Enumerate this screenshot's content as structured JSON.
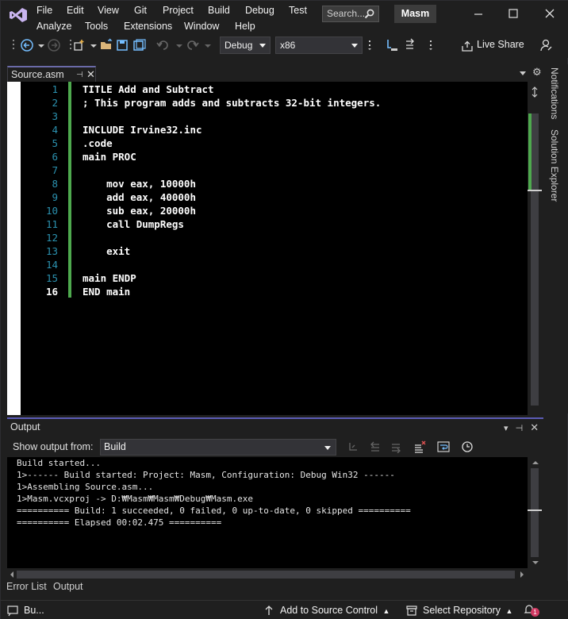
{
  "menu": {
    "row1": [
      "File",
      "Edit",
      "View",
      "Git",
      "Project",
      "Build",
      "Debug",
      "Test"
    ],
    "row2": [
      "Analyze",
      "Tools",
      "Extensions",
      "Window",
      "Help"
    ]
  },
  "search": {
    "placeholder": "Search..."
  },
  "solution_name": "Masm",
  "toolbar": {
    "configuration": "Debug",
    "platform": "x86",
    "live_share": "Live Share"
  },
  "editor": {
    "tab_label": "Source.asm",
    "lines": [
      {
        "n": "1",
        "text": "TITLE Add and Subtract"
      },
      {
        "n": "2",
        "text": "; This program adds and subtracts 32-bit integers."
      },
      {
        "n": "3",
        "text": ""
      },
      {
        "n": "4",
        "text": "INCLUDE Irvine32.inc"
      },
      {
        "n": "5",
        "text": ".code"
      },
      {
        "n": "6",
        "text": "main PROC"
      },
      {
        "n": "7",
        "text": ""
      },
      {
        "n": "8",
        "text": "    mov eax, 10000h"
      },
      {
        "n": "9",
        "text": "    add eax, 40000h"
      },
      {
        "n": "10",
        "text": "    sub eax, 20000h"
      },
      {
        "n": "11",
        "text": "    call DumpRegs"
      },
      {
        "n": "12",
        "text": ""
      },
      {
        "n": "13",
        "text": "    exit"
      },
      {
        "n": "14",
        "text": ""
      },
      {
        "n": "15",
        "text": "main ENDP"
      },
      {
        "n": "16",
        "text": "END main"
      }
    ]
  },
  "side_tabs": {
    "notifications": "Notifications",
    "solution_explorer": "Solution Explorer"
  },
  "output": {
    "title": "Output",
    "show_from_label": "Show output from:",
    "source": "Build",
    "lines": [
      "Build started...",
      "1>------ Build started: Project: Masm, Configuration: Debug Win32 ------",
      "1>Assembling Source.asm...",
      "1>Masm.vcxproj -> D:₩Masm₩Masm₩Debug₩Masm.exe",
      "========== Build: 1 succeeded, 0 failed, 0 up-to-date, 0 skipped ==========",
      "========== Elapsed 00:02.475 =========="
    ]
  },
  "bottom_tabs": {
    "error_list": "Error List",
    "output": "Output"
  },
  "status": {
    "build": "Bu...",
    "source_control": "Add to Source Control",
    "repository": "Select Repository",
    "notification_count": "1"
  },
  "colors": {
    "background": "#1f1f1f",
    "editor_bg": "#000000",
    "line_number": "#2b91af",
    "change_bar": "#4ea94e",
    "accent": "#6a6aa8"
  }
}
